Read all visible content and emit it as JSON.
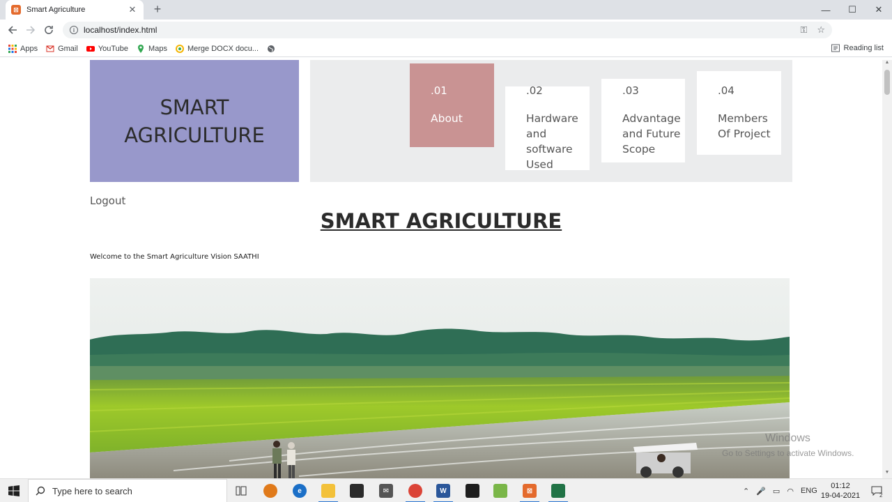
{
  "browser": {
    "tab_title": "Smart Agriculture",
    "url": "localhost/index.html",
    "bookmarks": [
      {
        "label": "Apps",
        "icon": "apps-grid-icon",
        "color": "#ea4335"
      },
      {
        "label": "Gmail",
        "icon": "gmail-icon",
        "color": "#d93025"
      },
      {
        "label": "YouTube",
        "icon": "youtube-icon",
        "color": "#ff0000"
      },
      {
        "label": "Maps",
        "icon": "maps-pin-icon",
        "color": "#34a853"
      },
      {
        "label": "Merge DOCX docu...",
        "icon": "merge-docx-icon",
        "color": "#f4b400"
      }
    ],
    "reading_list": "Reading list"
  },
  "page": {
    "brand": "SMART AGRICULTURE",
    "menu": [
      {
        "num": ".01",
        "label": "About",
        "active": true
      },
      {
        "num": ".02",
        "label": "Hardware and software Used",
        "active": false
      },
      {
        "num": ".03",
        "label": "Advantage and Future Scope",
        "active": false
      },
      {
        "num": ".04",
        "label": "Members Of Project",
        "active": false
      }
    ],
    "logout": "Logout",
    "heading": "SMART AGRICULTURE",
    "welcome": "Welcome to the Smart Agriculture Vision SAATHI",
    "hero_image": "rice paddy field with farmers and tractor"
  },
  "watermark": {
    "line1": "Windows",
    "line2": "Go to Settings to activate Windows."
  },
  "taskbar": {
    "search_placeholder": "Type here to search",
    "language": "ENG",
    "time": "01:12",
    "date": "19-04-2021",
    "notification_count": "2"
  },
  "colors": {
    "brand_bg": "#9898cb",
    "menu_panel_bg": "#ebeced",
    "active_card_bg": "#c99393"
  }
}
